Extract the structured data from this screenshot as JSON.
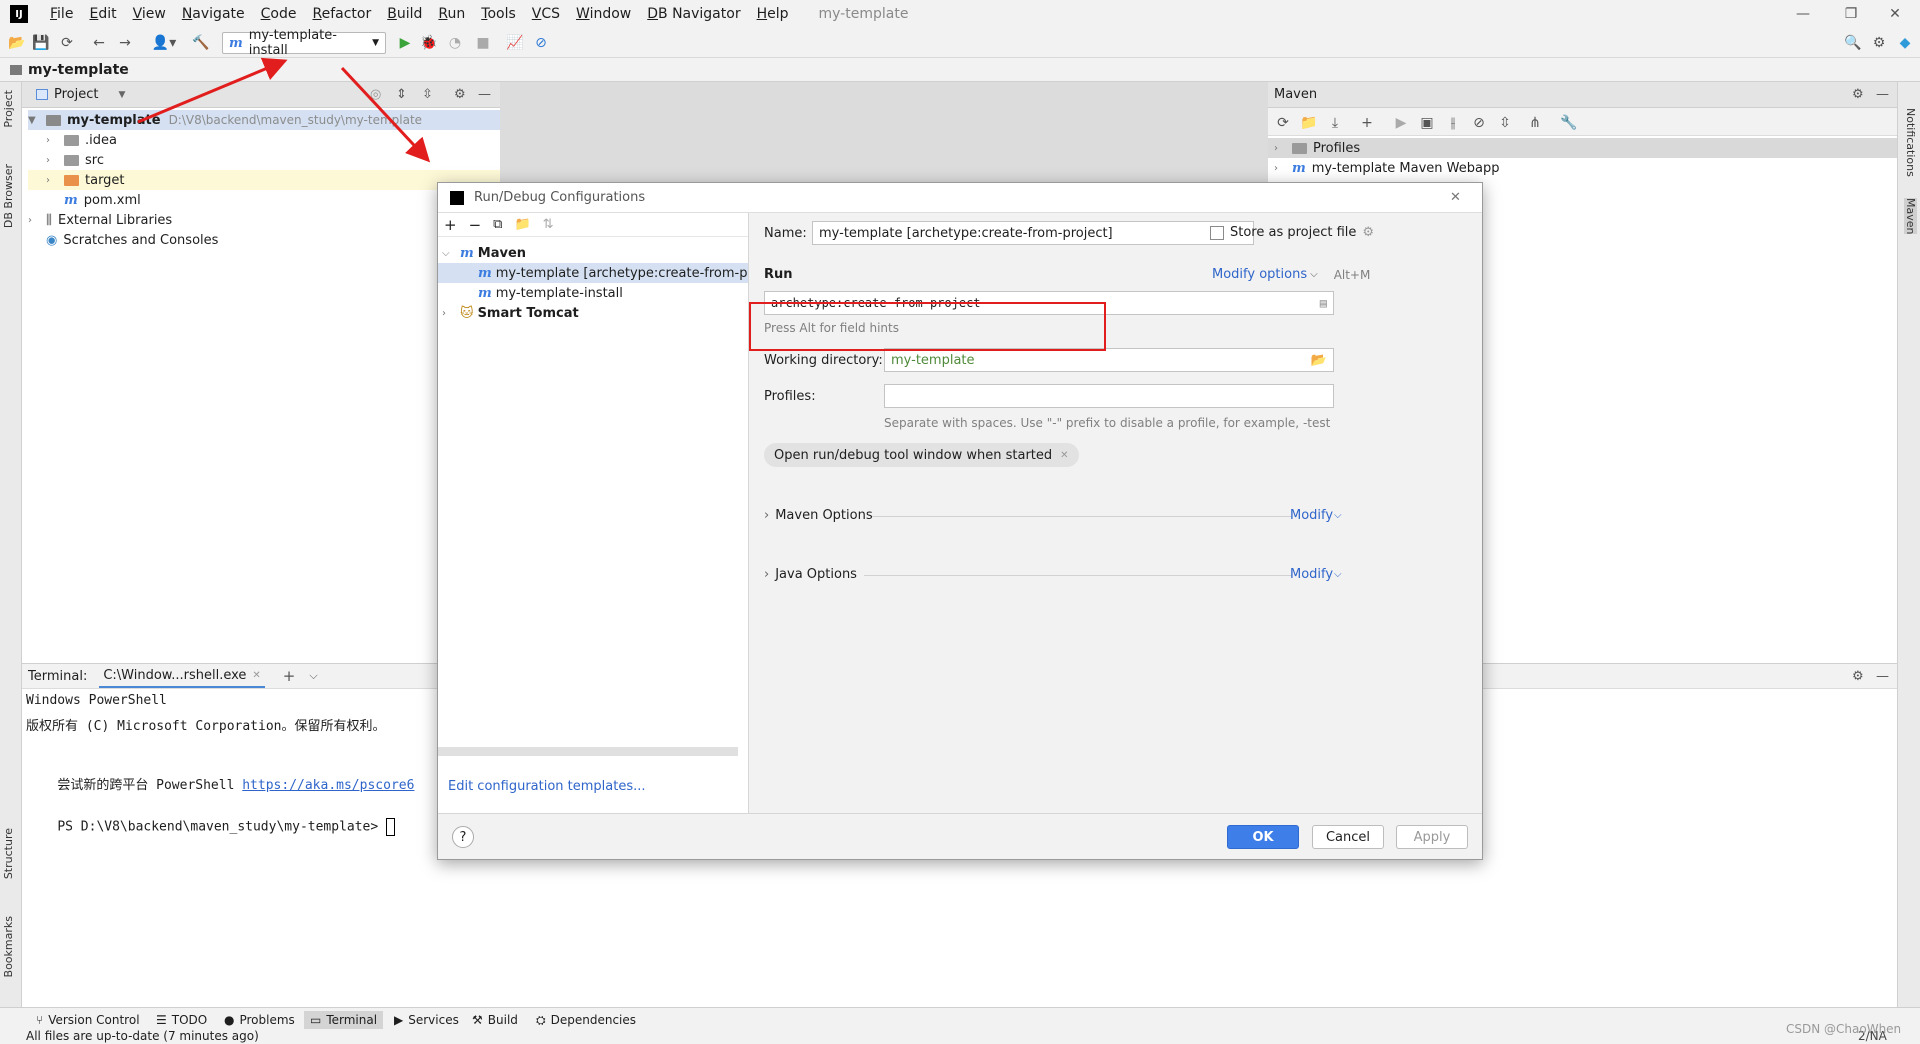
{
  "menubar": {
    "items": [
      "File",
      "Edit",
      "View",
      "Navigate",
      "Code",
      "Refactor",
      "Build",
      "Run",
      "Tools",
      "VCS",
      "Window",
      "DB Navigator",
      "Help"
    ],
    "project_title": "my-template",
    "logo": "IJ"
  },
  "toolbar": {
    "run_config": "my-template-install"
  },
  "navbar": {
    "project": "my-template"
  },
  "left_stripe": {
    "project": "Project",
    "db_browser": "DB Browser",
    "structure": "Structure",
    "bookmarks": "Bookmarks"
  },
  "right_stripe": {
    "notifications": "Notifications",
    "maven": "Maven"
  },
  "project_panel": {
    "view": "Project",
    "root_name": "my-template",
    "root_path": "D:\\V8\\backend\\maven_study\\my-template",
    "items": [
      ".idea",
      "src",
      "target",
      "pom.xml",
      "External Libraries",
      "Scratches and Consoles"
    ]
  },
  "maven_panel": {
    "title": "Maven",
    "items": [
      "Profiles",
      "my-template Maven Webapp"
    ]
  },
  "terminal": {
    "label": "Terminal:",
    "tab": "C:\\Window...rshell.exe",
    "lines": [
      "Windows PowerShell",
      "版权所有 (C) Microsoft Corporation。保留所有权利。",
      "",
      "尝试新的跨平台 PowerShell "
    ],
    "link": "https://aka.ms/pscore6",
    "prompt": "PS D:\\V8\\backend\\maven_study\\my-template> "
  },
  "bottom_tabs": [
    "Version Control",
    "TODO",
    "Problems",
    "Terminal",
    "Services",
    "Build",
    "Dependencies"
  ],
  "status": {
    "message": "All files are up-to-date (7 minutes ago)",
    "watermark": "CSDN @ChaoWhen",
    "right": "2/NA"
  },
  "dialog": {
    "title": "Run/Debug Configurations",
    "tree": {
      "maven": "Maven",
      "config_selected": "my-template [archetype:create-from-project]",
      "config_install": "my-template-install",
      "smart_tomcat": "Smart Tomcat"
    },
    "edit_templates": "Edit configuration templates...",
    "name_label": "Name:",
    "name_value": "my-template [archetype:create-from-project]",
    "store_label": "Store as project file",
    "run_section": "Run",
    "modify_options": "Modify options",
    "modify_shortcut": "Alt+M",
    "run_value": "archetype:create-from-project",
    "field_hint": "Press Alt for field hints",
    "working_dir_label": "Working directory:",
    "working_dir_value": "my-template",
    "profiles_label": "Profiles:",
    "profiles_value": "",
    "profiles_hint": "Separate with spaces. Use \"-\" prefix to disable a profile, for example, -test",
    "chip": "Open run/debug tool window when started",
    "maven_options": "Maven Options",
    "java_options": "Java Options",
    "modify": "Modify",
    "ok": "OK",
    "cancel": "Cancel",
    "apply": "Apply",
    "help": "?"
  },
  "colors": {
    "annotation_red": "#e21d1d",
    "ok_blue": "#3d7ee8",
    "link_blue": "#2f65ca"
  }
}
